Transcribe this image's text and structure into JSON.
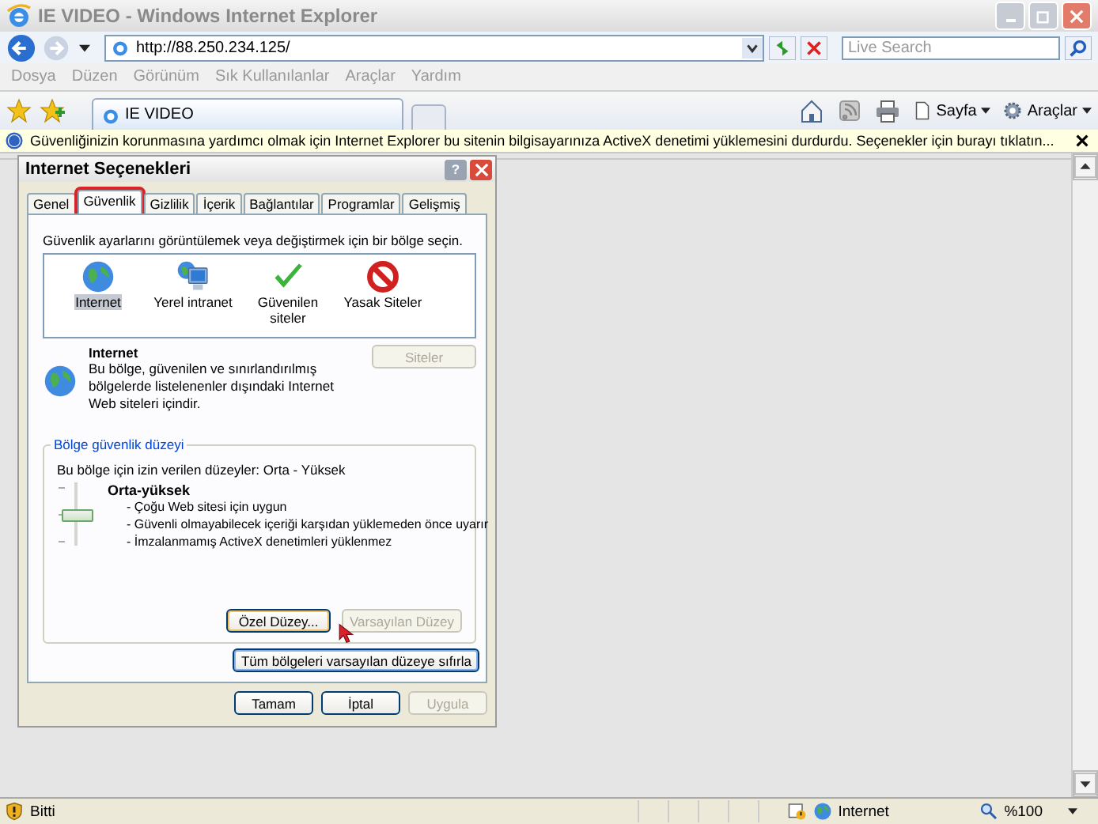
{
  "window": {
    "title": "IE VIDEO - Windows Internet Explorer"
  },
  "address_bar": {
    "url": "http://88.250.234.125/"
  },
  "search": {
    "placeholder": "Live Search"
  },
  "menu": [
    "Dosya",
    "Düzen",
    "Görünüm",
    "Sık Kullanılanlar",
    "Araçlar",
    "Yardım"
  ],
  "browser_tabs": [
    {
      "label": "IE VIDEO",
      "selected": true
    }
  ],
  "command_bar": [
    {
      "label": "Sayfa",
      "kind": "page"
    },
    {
      "label": "Araçlar",
      "kind": "tools"
    }
  ],
  "info_bar": {
    "text": "Güvenliğinizin korunmasına yardımcı olmak için Internet Explorer bu sitenin bilgisayarınıza ActiveX denetimi yüklemesini durdurdu. Seçenekler için burayı tıklatın..."
  },
  "dialog": {
    "title": "Internet Seçenekleri",
    "help_button": "?",
    "tabs": [
      {
        "label": "Genel",
        "selected": false,
        "highlighted": false
      },
      {
        "label": "Güvenlik",
        "selected": true,
        "highlighted": true
      },
      {
        "label": "Gizlilik",
        "selected": false,
        "highlighted": false
      },
      {
        "label": "İçerik",
        "selected": false,
        "highlighted": false
      },
      {
        "label": "Bağlantılar",
        "selected": false,
        "highlighted": false
      },
      {
        "label": "Programlar",
        "selected": false,
        "highlighted": false
      },
      {
        "label": "Gelişmiş",
        "selected": false,
        "highlighted": false
      }
    ],
    "instruction": "Güvenlik ayarlarını görüntülemek veya değiştirmek için bir bölge seçin.",
    "zones": [
      {
        "label": "Internet",
        "kind": "globe",
        "selected": true
      },
      {
        "label": "Yerel intranet",
        "kind": "computer",
        "selected": false
      },
      {
        "label": "Güvenilen siteler",
        "kind": "check",
        "selected": false
      },
      {
        "label": "Yasak Siteler",
        "kind": "forbidden",
        "selected": false
      }
    ],
    "zone_info": {
      "title": "Internet",
      "description": "Bu bölge, güvenilen ve sınırlandırılmış bölgelerde listelenenler dışındaki Internet Web siteleri içindir."
    },
    "sites_button": {
      "label": "Siteler",
      "disabled": true
    },
    "group": {
      "title": "Bölge güvenlik düzeyi",
      "allowed_levels": "Bu bölge için izin verilen düzeyler: Orta - Yüksek",
      "slider": {
        "level": 0.5
      },
      "level_name": "Orta-yüksek",
      "bullets": [
        "- Çoğu Web sitesi için uygun",
        "- Güvenli olmayabilecek içeriği karşıdan yüklemeden önce uyarır",
        "- İmzalanmamış ActiveX denetimleri yüklenmez"
      ]
    },
    "custom_button": {
      "label": "Özel Düzey...",
      "disabled": false
    },
    "default_button": {
      "label": "Varsayılan Düzey",
      "disabled": true
    },
    "reset_all_button": {
      "label": "Tüm bölgeleri varsayılan düzeye sıfırla",
      "disabled": false
    },
    "footer_buttons": [
      {
        "label": "Tamam",
        "disabled": false
      },
      {
        "label": "İptal",
        "disabled": false
      },
      {
        "label": "Uygula",
        "disabled": true
      }
    ]
  },
  "status_bar": {
    "text": "Bitti",
    "zone": "Internet",
    "zoom": "%100"
  }
}
